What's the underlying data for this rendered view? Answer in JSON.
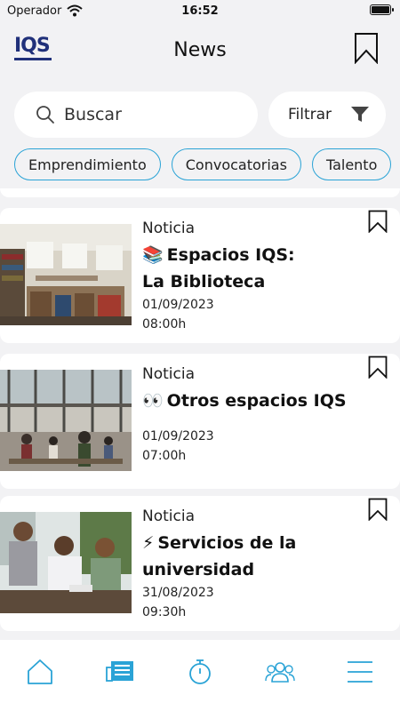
{
  "status_bar": {
    "carrier": "Operador",
    "time": "16:52"
  },
  "header": {
    "logo_text": "IQS",
    "title": "News",
    "bookmark_icon": "bookmark-icon"
  },
  "search": {
    "placeholder": "Buscar",
    "filter_label": "Filtrar",
    "filter_icon": "filter-icon"
  },
  "chips": [
    "Emprendimiento",
    "Convocatorias",
    "Talento"
  ],
  "news": [
    {
      "type": "Noticia",
      "emoji": "📚",
      "title_line1": "Espacios IQS:",
      "title_line2": "La Biblioteca",
      "date": "01/09/2023",
      "time": "08:00h",
      "image": "library-photo"
    },
    {
      "type": "Noticia",
      "emoji": "👀",
      "title_line1": "Otros espacios IQS",
      "title_line2": "",
      "date": "01/09/2023",
      "time": "07:00h",
      "image": "campus-hall-photo"
    },
    {
      "type": "Noticia",
      "emoji": "⚡",
      "title_line1": "Servicios de la",
      "title_line2": "universidad",
      "date": "31/08/2023",
      "time": "09:30h",
      "image": "students-photo"
    }
  ],
  "tabs": [
    {
      "name": "home",
      "icon": "home-icon"
    },
    {
      "name": "news",
      "icon": "newspaper-icon",
      "active": true
    },
    {
      "name": "timer",
      "icon": "stopwatch-icon"
    },
    {
      "name": "community",
      "icon": "people-icon"
    },
    {
      "name": "menu",
      "icon": "menu-icon"
    }
  ],
  "colors": {
    "accent": "#2aa3d6",
    "logo": "#20307a",
    "background": "#f2f2f4"
  }
}
